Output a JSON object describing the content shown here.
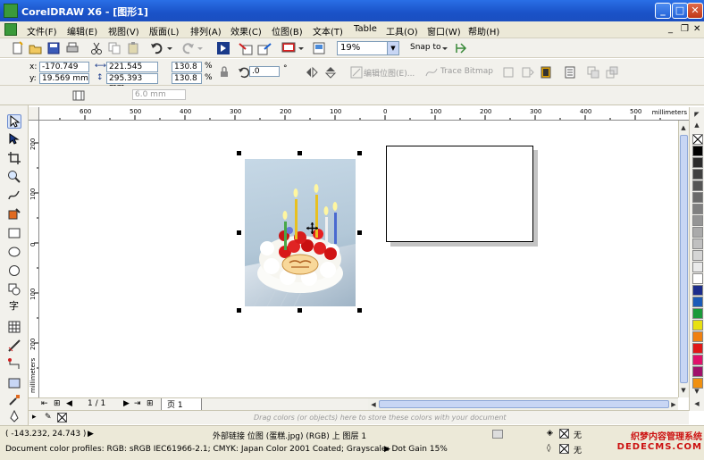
{
  "window": {
    "title": "CorelDRAW X6 - [图形1]",
    "minimize": "_",
    "maximize": "□",
    "close": "✕"
  },
  "menu": {
    "items": [
      "文件(F)",
      "编辑(E)",
      "视图(V)",
      "版面(L)",
      "排列(A)",
      "效果(C)",
      "位图(B)",
      "文本(T)",
      "Table",
      "工具(O)",
      "窗口(W)",
      "帮助(H)"
    ],
    "mdi_minimize": "_",
    "mdi_restore": "❐",
    "mdi_close": "✕"
  },
  "toolbar": {
    "zoom_value": "19%",
    "snap_label": "Snap to"
  },
  "property_bar": {
    "x_label": "x:",
    "x_value": "-170.749 mm",
    "y_label": "y:",
    "y_value": "19.569 mm",
    "width_value": "221.545 mm",
    "height_value": "295.393 mm",
    "scale_x": "130.8",
    "scale_y": "130.8",
    "percent": "%",
    "angle_value": ".0",
    "degree": "°",
    "edit_bitmap_label": "编辑位图(E)...",
    "trace_bitmap_label": "Trace Bitmap",
    "nudge_value": "6.0 mm"
  },
  "rulers": {
    "h_ticks": [
      "600",
      "500",
      "400",
      "300",
      "200",
      "100",
      "0",
      "100",
      "200",
      "300",
      "400",
      "500"
    ],
    "v_ticks": [
      "200",
      "100",
      "0",
      "100",
      "200"
    ],
    "units": "millimeters"
  },
  "page_nav": {
    "page_counter": "1 / 1",
    "page_tab": "页 1"
  },
  "document_palette": {
    "hint": "Drag colors (or objects) here to store these colors with your document"
  },
  "status": {
    "coordinates": "( -143.232, 24.743 )",
    "object_info": "外部链接 位图 (蛋糕.jpg) (RGB) 上 图层 1",
    "color_profiles": "Document color profiles: RGB: sRGB IEC61966-2.1; CMYK: Japan Color 2001 Coated; Grayscale: Dot Gain 15%",
    "fill_none": "无",
    "outline_none": "无"
  },
  "watermark": {
    "line1": "织梦内容管理系统",
    "line2": "DEDECMS.COM"
  },
  "palette_colors": [
    "#ffffff",
    "#000000",
    "#2b2b2b",
    "#404040",
    "#555555",
    "#6a6a6a",
    "#808080",
    "#959595",
    "#aaaaaa",
    "#c0c0c0",
    "#d5d5d5",
    "#eaeaea",
    "#ffffff",
    "#1b2c8c",
    "#1a5ab8",
    "#1a9a3a",
    "#e8e010",
    "#f08010",
    "#e01818",
    "#e0106a",
    "#a0106a",
    "#f09010"
  ]
}
